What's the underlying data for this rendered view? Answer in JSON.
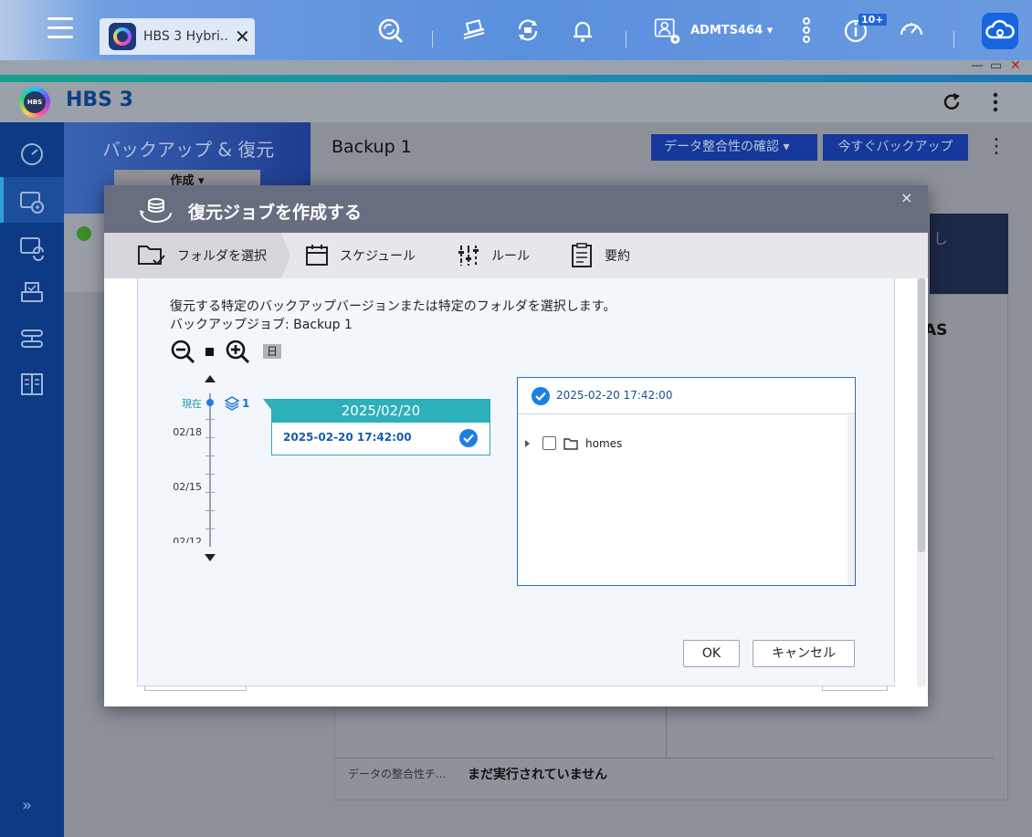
{
  "os": {
    "tab_title": "HBS 3 Hybri...",
    "tab_close": "✕",
    "username": "ADMTS464",
    "user_caret": "▾",
    "notif_badge": "10+",
    "window_controls": [
      "—",
      "▭",
      "✕"
    ]
  },
  "app": {
    "title": "HBS 3",
    "refresh_icon": "refresh-icon",
    "more_icon": "more-vertical-icon"
  },
  "sidebar": {
    "items": [
      "overview-icon",
      "backup-restore-icon",
      "sync-icon",
      "storage-icon",
      "services-icon",
      "logs-icon"
    ],
    "active_index": 1,
    "expand": "»"
  },
  "left_panel": {
    "banner_title": "バックアップ & 復元",
    "create_button": "作成 ▾"
  },
  "main": {
    "job_title": "Backup 1",
    "verify_button": "データ整合性の確認 ▾",
    "backup_now_button": "今すぐバックアップ",
    "kebab": "⋮",
    "nas_label": "AS",
    "integrity_label": "データの整合性チ...",
    "integrity_value": "まだ実行されていません",
    "partial_banner_text": "し"
  },
  "modal": {
    "title": "復元ジョブを作成する",
    "close": "×",
    "steps": [
      {
        "label": "フォルダを選択",
        "icon": "folder-check-icon",
        "active": true
      },
      {
        "label": "スケジュール",
        "icon": "calendar-icon",
        "active": false
      },
      {
        "label": "ルール",
        "icon": "sliders-icon",
        "active": false
      },
      {
        "label": "要約",
        "icon": "clipboard-icon",
        "active": false
      }
    ],
    "description": "復元する特定のバックアップバージョンまたは特定のフォルダを選択します。",
    "job_label": "バックアップジョブ:  Backup 1",
    "zoom_level": "日",
    "timeline": {
      "now_label": "現在",
      "version_count": "1",
      "dates": [
        "02/18",
        "02/15",
        "02/12"
      ]
    },
    "version_card": {
      "date": "2025/02/20",
      "time": "2025-02-20 17:42:00",
      "selected": true
    },
    "tree": {
      "header_time": "2025-02-20 17:42:00",
      "items": [
        {
          "name": "homes",
          "checked": false
        }
      ]
    },
    "ok_button": "OK",
    "cancel_button": "キャンセル"
  },
  "colors": {
    "accent_blue": "#1d7ee6",
    "teal": "#2bb0bc",
    "modal_header": "#676e80",
    "sidebar": "#0c3a84"
  }
}
